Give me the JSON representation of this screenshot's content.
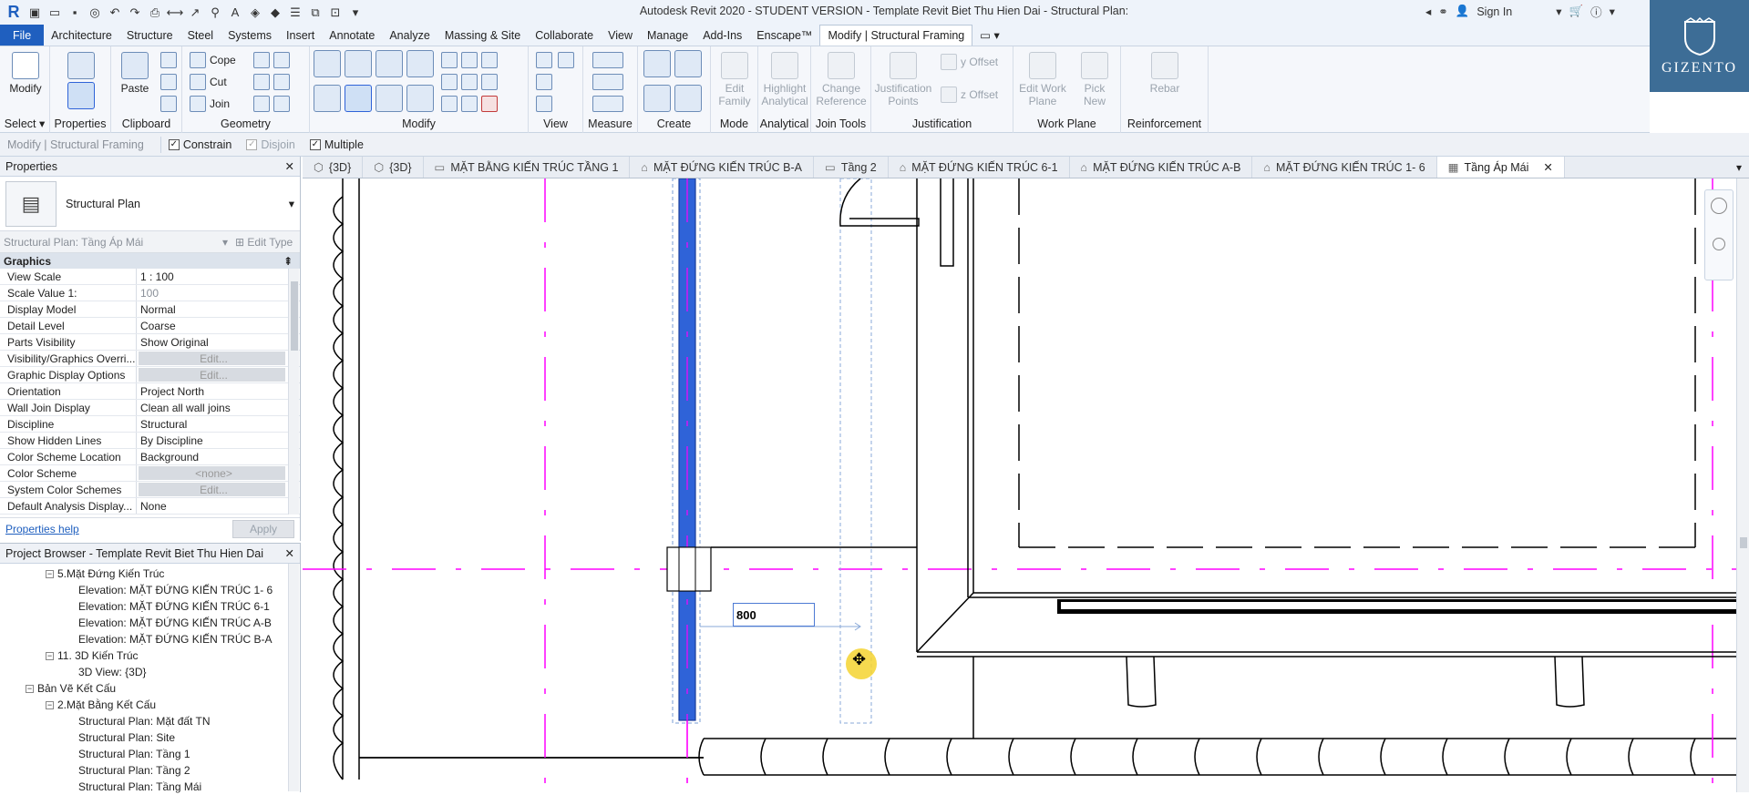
{
  "window": {
    "title": "Autodesk Revit 2020 - STUDENT VERSION - Template Revit Biet Thu Hien Dai - Structural Plan: Tầng Áp Mái",
    "sign_in": "Sign In"
  },
  "ribbon_tabs": [
    "File",
    "Architecture",
    "Structure",
    "Steel",
    "Systems",
    "Insert",
    "Annotate",
    "Analyze",
    "Massing & Site",
    "Collaborate",
    "View",
    "Manage",
    "Add-Ins",
    "Enscape™",
    "Modify | Structural Framing"
  ],
  "ribbon": {
    "select": {
      "modify": "Modify",
      "label": "Select"
    },
    "properties": {
      "label": "Properties"
    },
    "clipboard": {
      "paste": "Paste",
      "label": "Clipboard"
    },
    "geometry": {
      "cope": "Cope",
      "cut": "Cut",
      "join": "Join",
      "label": "Geometry"
    },
    "modify": {
      "label": "Modify"
    },
    "view": {
      "label": "View"
    },
    "measure": {
      "label": "Measure"
    },
    "create": {
      "label": "Create"
    },
    "mode": {
      "edit_family": "Edit Family",
      "label": "Mode"
    },
    "analytical": {
      "highlight": "Highlight Analytical",
      "label": "Analytical"
    },
    "join_tools": {
      "change_reference": "Change Reference",
      "label": "Join Tools"
    },
    "justification": {
      "points": "Justification Points",
      "y_offset": "y Offset",
      "z_offset": "z Offset",
      "label": "Justification"
    },
    "work_plane": {
      "edit": "Edit Work Plane",
      "pick_new": "Pick New",
      "label": "Work Plane"
    },
    "reinforcement": {
      "rebar": "Rebar",
      "label": "Reinforcement"
    }
  },
  "brand": {
    "logo_text": "GIZENTO",
    "letter": "G"
  },
  "options_bar": {
    "context": "Modify | Structural Framing",
    "constrain": "Constrain",
    "disjoin": "Disjoin",
    "multiple": "Multiple"
  },
  "properties": {
    "title": "Properties",
    "type_name": "Structural Plan",
    "instance": "Structural Plan: Tầng Áp Mái",
    "edit_type": "Edit Type",
    "group": "Graphics",
    "rows": [
      {
        "k": "View Scale",
        "v": "1 : 100"
      },
      {
        "k": "Scale Value    1:",
        "v": "100"
      },
      {
        "k": "Display Model",
        "v": "Normal"
      },
      {
        "k": "Detail Level",
        "v": "Coarse"
      },
      {
        "k": "Parts Visibility",
        "v": "Show Original"
      },
      {
        "k": "Visibility/Graphics Overri...",
        "v": "Edit..."
      },
      {
        "k": "Graphic Display Options",
        "v": "Edit..."
      },
      {
        "k": "Orientation",
        "v": "Project North"
      },
      {
        "k": "Wall Join Display",
        "v": "Clean all wall joins"
      },
      {
        "k": "Discipline",
        "v": "Structural"
      },
      {
        "k": "Show Hidden Lines",
        "v": "By Discipline"
      },
      {
        "k": "Color Scheme Location",
        "v": "Background"
      },
      {
        "k": "Color Scheme",
        "v": "<none>"
      },
      {
        "k": "System Color Schemes",
        "v": "Edit..."
      },
      {
        "k": "Default Analysis Display...",
        "v": "None"
      }
    ],
    "help": "Properties help",
    "apply": "Apply"
  },
  "project_browser": {
    "title": "Project Browser - Template Revit Biet Thu Hien Dai",
    "items": [
      {
        "text": "5.Mặt Đứng Kiến Trúc",
        "indent": 1,
        "toggle": "−"
      },
      {
        "text": "Elevation: MẶT ĐỨNG KIẾN TRÚC 1- 6",
        "indent": 2,
        "toggle": ""
      },
      {
        "text": "Elevation: MẶT ĐỨNG KIẾN TRÚC 6-1",
        "indent": 2,
        "toggle": ""
      },
      {
        "text": "Elevation: MẶT ĐỨNG KIẾN TRÚC A-B",
        "indent": 2,
        "toggle": ""
      },
      {
        "text": "Elevation: MẶT ĐỨNG KIẾN TRÚC B-A",
        "indent": 2,
        "toggle": ""
      },
      {
        "text": "11. 3D Kiến Trúc",
        "indent": 1,
        "toggle": "−"
      },
      {
        "text": "3D View: {3D}",
        "indent": 2,
        "toggle": ""
      },
      {
        "text": "Bản Vẽ Kết Cấu",
        "indent": 0,
        "toggle": "−"
      },
      {
        "text": "2.Mặt Bằng Kết Cấu",
        "indent": 1,
        "toggle": "−"
      },
      {
        "text": "Structural Plan: Mặt đất TN",
        "indent": 2,
        "toggle": ""
      },
      {
        "text": "Structural Plan: Site",
        "indent": 2,
        "toggle": ""
      },
      {
        "text": "Structural Plan: Tầng 1",
        "indent": 2,
        "toggle": ""
      },
      {
        "text": "Structural Plan: Tầng 2",
        "indent": 2,
        "toggle": ""
      },
      {
        "text": "Structural Plan: Tầng Mái",
        "indent": 2,
        "toggle": ""
      }
    ]
  },
  "view_tabs": [
    {
      "label": "{3D}",
      "icon": "3d-icon"
    },
    {
      "label": "{3D}",
      "icon": "3d-icon"
    },
    {
      "label": "MẶT BẰNG KIẾN TRÚC TẦNG 1",
      "icon": "plan-icon"
    },
    {
      "label": "MẶT ĐỨNG KIẾN TRÚC B-A",
      "icon": "elevation-icon"
    },
    {
      "label": "Tầng 2",
      "icon": "plan-icon"
    },
    {
      "label": "MẶT ĐỨNG KIẾN TRÚC 6-1",
      "icon": "elevation-icon"
    },
    {
      "label": "MẶT ĐỨNG KIẾN TRÚC A-B",
      "icon": "elevation-icon"
    },
    {
      "label": "MẶT ĐỨNG KIẾN TRÚC 1- 6",
      "icon": "elevation-icon"
    },
    {
      "label": "Tầng Áp Mái",
      "icon": "structural-plan-icon",
      "active": true
    }
  ],
  "canvas": {
    "dimension_input": "800",
    "colors": {
      "gridline": "#ff00ff",
      "selected_beam": "#2f63d8",
      "cursor_highlight": "#f5d330"
    }
  }
}
